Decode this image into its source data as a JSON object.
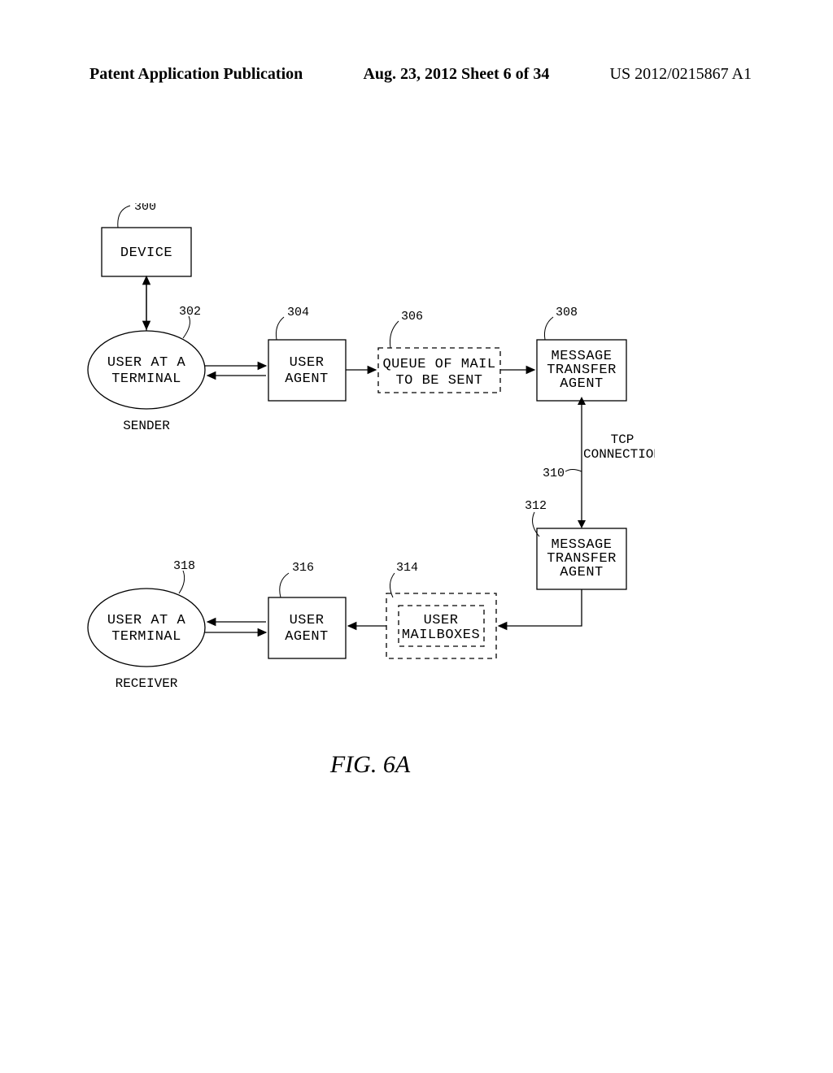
{
  "header": {
    "left": "Patent Application Publication",
    "mid": "Aug. 23, 2012  Sheet 6 of 34",
    "right": "US 2012/0215867 A1"
  },
  "figure": {
    "title": "FIG. 6A",
    "tcp_label": "TCP CONNECTION",
    "sender_label": "SENDER",
    "receiver_label": "RECEIVER",
    "nodes": {
      "device": {
        "ref": "300",
        "lines": [
          "DEVICE"
        ]
      },
      "sender_terminal": {
        "ref": "302",
        "lines": [
          "USER AT A",
          "TERMINAL"
        ]
      },
      "user_agent_top": {
        "ref": "304",
        "lines": [
          "USER",
          "AGENT"
        ]
      },
      "queue": {
        "ref": "306",
        "lines": [
          "QUEUE OF MAIL",
          "TO BE SENT"
        ]
      },
      "mta_top": {
        "ref": "308",
        "lines": [
          "MESSAGE",
          "TRANSFER",
          "AGENT"
        ]
      },
      "tcp": {
        "ref": "310"
      },
      "mta_bottom": {
        "ref": "312",
        "lines": [
          "MESSAGE",
          "TRANSFER",
          "AGENT"
        ]
      },
      "mailboxes": {
        "ref": "314",
        "lines": [
          "USER",
          "MAILBOXES"
        ]
      },
      "user_agent_bottom": {
        "ref": "316",
        "lines": [
          "USER",
          "AGENT"
        ]
      },
      "receiver_terminal": {
        "ref": "318",
        "lines": [
          "USER AT A",
          "TERMINAL"
        ]
      }
    }
  }
}
